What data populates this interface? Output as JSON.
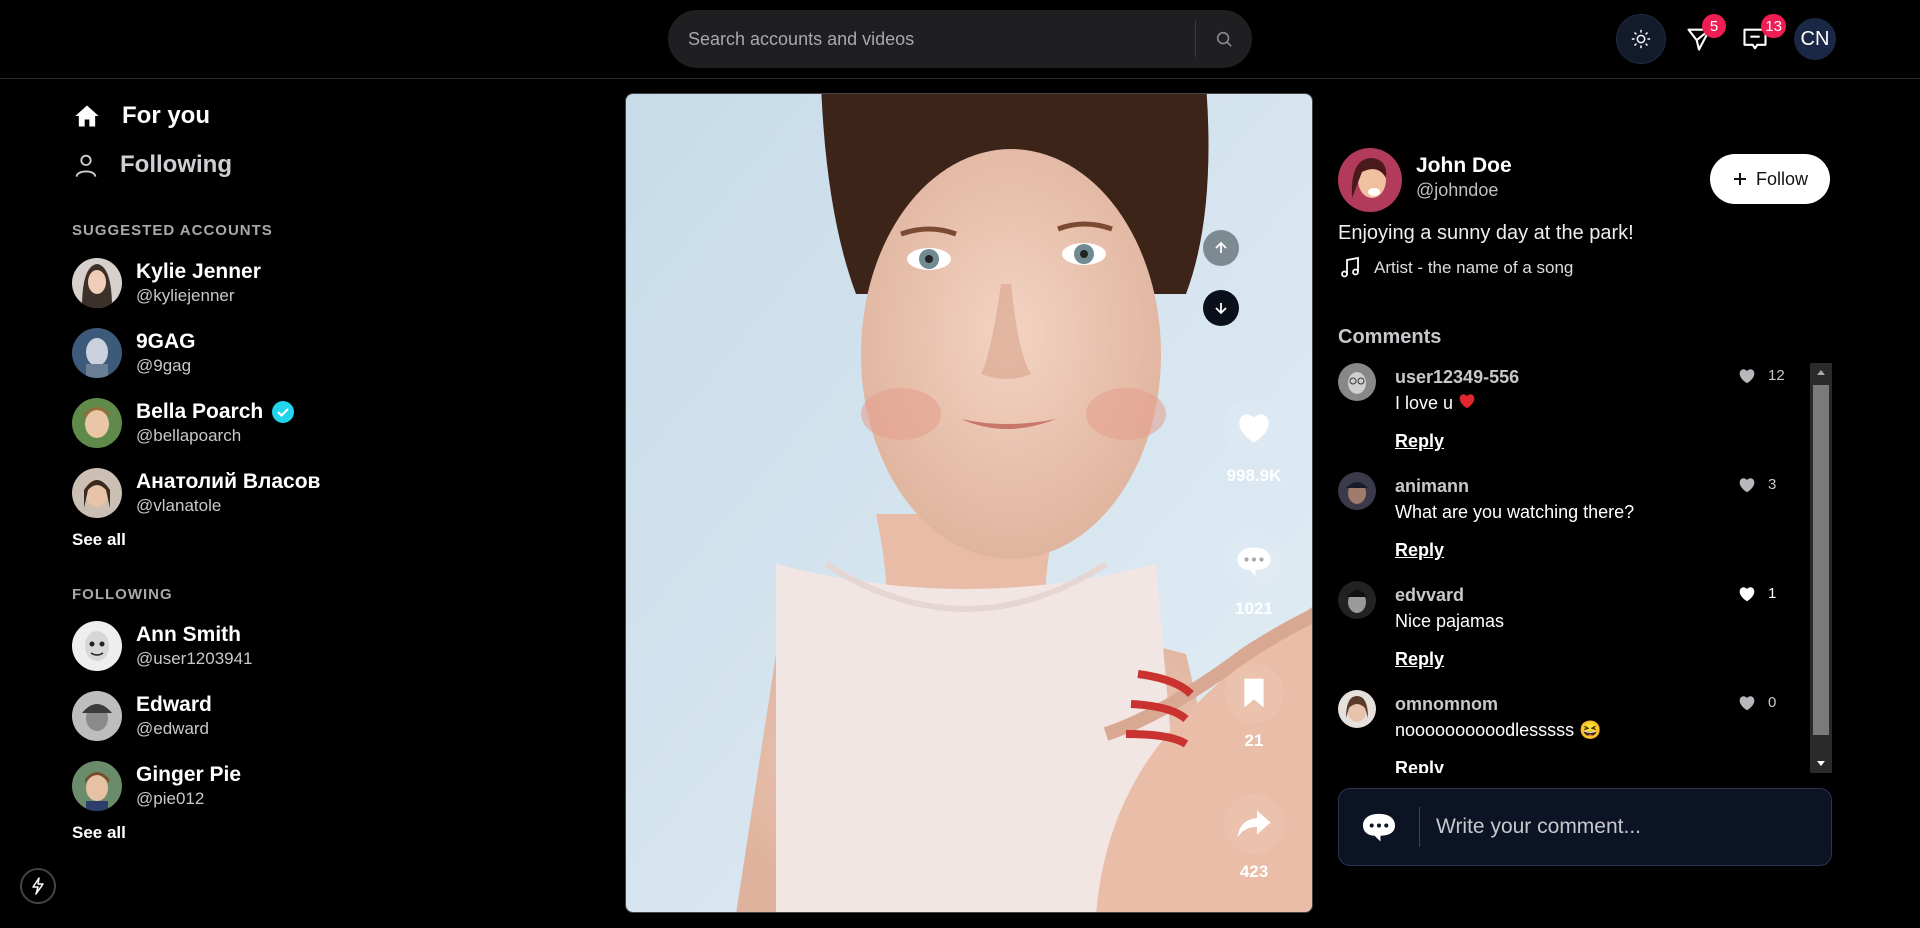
{
  "search": {
    "placeholder": "Search accounts and videos"
  },
  "header": {
    "inbox_badge": "5",
    "messages_badge": "13",
    "avatar_initials": "CN"
  },
  "nav": {
    "for_you": "For you",
    "following": "Following"
  },
  "suggested": {
    "title": "SUGGESTED ACCOUNTS",
    "accounts": [
      {
        "name": "Kylie Jenner",
        "handle": "@kyliejenner"
      },
      {
        "name": "9GAG",
        "handle": "@9gag"
      },
      {
        "name": "Bella Poarch",
        "handle": "@bellapoarch",
        "verified": true
      },
      {
        "name": "Анатолий Власов",
        "handle": "@vlanatole"
      }
    ],
    "see_all": "See all"
  },
  "following": {
    "title": "FOLLOWING",
    "accounts": [
      {
        "name": "Ann Smith",
        "handle": "@user1203941"
      },
      {
        "name": "Edward",
        "handle": "@edward"
      },
      {
        "name": "Ginger Pie",
        "handle": "@pie012"
      }
    ],
    "see_all": "See all"
  },
  "video": {
    "likes": "998.9K",
    "comments": "1021",
    "saves": "21",
    "shares": "423"
  },
  "author": {
    "name": "John Doe",
    "handle": "@johndoe",
    "follow_label": "Follow",
    "caption": "Enjoying a sunny day at the park!",
    "song": "Artist - the name of a song"
  },
  "comments": {
    "title": "Comments",
    "items": [
      {
        "user": "user12349-556",
        "text": "I love u ",
        "likes": "12",
        "reply": "Reply"
      },
      {
        "user": "animann",
        "text": "What are you watching there?",
        "likes": "3",
        "reply": "Reply"
      },
      {
        "user": "edvvard",
        "text": "Nice pajamas",
        "likes": "1",
        "reply": "Reply"
      },
      {
        "user": "omnomnom",
        "text": "noooooooooodlesssss 😆",
        "likes": "0",
        "reply": "Reply"
      }
    ],
    "compose_placeholder": "Write your comment..."
  },
  "colors": {
    "accent": "#ee1d52",
    "verified": "#20d5ec"
  }
}
